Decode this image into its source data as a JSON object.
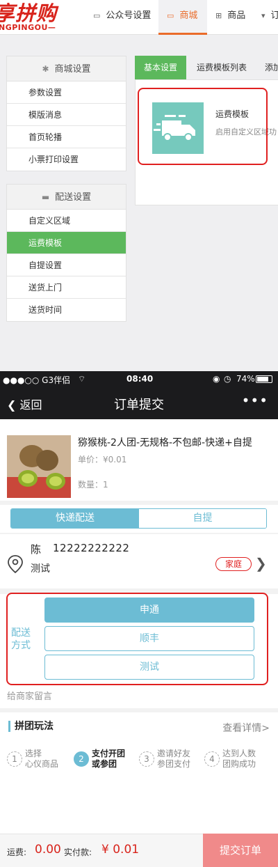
{
  "admin": {
    "logo": {
      "cn": "享拼购",
      "en": "NGPINGOU—"
    },
    "nav": [
      {
        "label": "公众号设置",
        "icon": "monitor-icon"
      },
      {
        "label": "商城",
        "icon": "monitor-icon",
        "active": true
      },
      {
        "label": "商品",
        "icon": "gift-icon"
      },
      {
        "label": "订",
        "icon": "cart-icon"
      }
    ],
    "mall_settings": {
      "title": "商城设置",
      "items": [
        "参数设置",
        "模版消息",
        "首页轮播",
        "小票打印设置"
      ]
    },
    "delivery_settings": {
      "title": "配送设置",
      "items": [
        "自定义区域",
        "运费模板",
        "自提设置",
        "送货上门",
        "送货时间"
      ],
      "active_index": 1
    },
    "tabs": [
      "基本设置",
      "运费模板列表",
      "添加"
    ],
    "card": {
      "title": "运费模板",
      "desc": "启用自定义区域功"
    }
  },
  "phone": {
    "status": {
      "carrier": "●●●○○ G3伴侣",
      "time": "08:40",
      "battery": "74%"
    },
    "nav": {
      "back": "返回",
      "title": "订单提交",
      "more": "•••"
    },
    "product": {
      "title": "猕猴桃-2人团-无规格-不包邮-快递+自提",
      "price": "单价：¥0.01",
      "qty": "数量：1"
    },
    "delivery_tabs": {
      "express": "快递配送",
      "pickup": "自提"
    },
    "address": {
      "name": "陈",
      "phone": "12222222222",
      "detail": "测试",
      "tag": "家庭"
    },
    "shipping": {
      "label": "配送方式",
      "options": [
        "申通",
        "顺丰",
        "测试"
      ],
      "selected": 0
    },
    "note_placeholder": "给商家留言",
    "group": {
      "title": "拼团玩法",
      "link": "查看详情>",
      "steps": [
        {
          "num": "1",
          "line1": "选择",
          "line2": "心仪商品"
        },
        {
          "num": "2",
          "line1": "支付开团",
          "line2": "或参团",
          "current": true
        },
        {
          "num": "3",
          "line1": "邀请好友",
          "line2": "参团支付"
        },
        {
          "num": "4",
          "line1": "达到人数",
          "line2": "团购成功"
        }
      ]
    },
    "footer": {
      "shipping_label": "运费:",
      "shipping_amount": "0.00",
      "pay_label": "实付款:",
      "pay_amount": "¥ 0.01",
      "submit": "提交订单"
    }
  },
  "colors": {
    "brand_red": "#d8231b",
    "green": "#5cb85c",
    "blue": "#6cbcd4",
    "highlight_red": "#e02020"
  }
}
